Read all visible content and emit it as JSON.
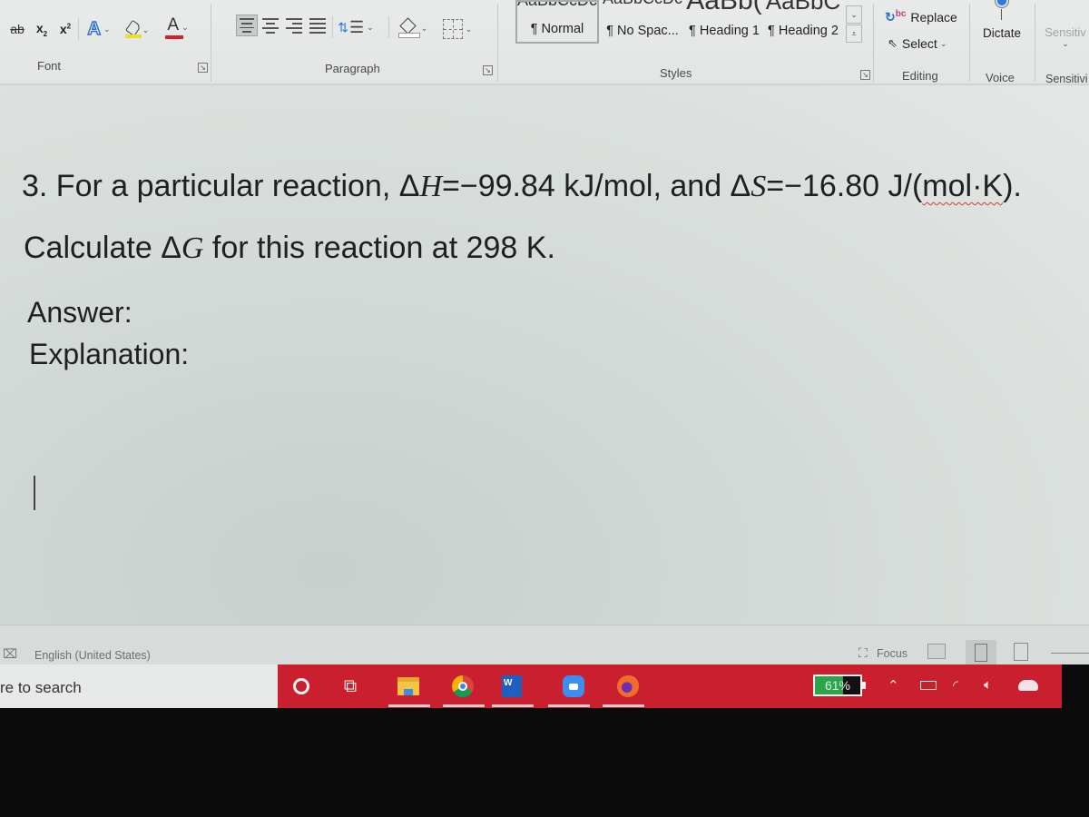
{
  "ribbon": {
    "font_group": {
      "label": "Font",
      "buttons": {
        "strikethrough": "ab",
        "subscript": "x",
        "superscript": "x",
        "text_effects": "A",
        "font_color": "A"
      }
    },
    "paragraph_group": {
      "label": "Paragraph"
    },
    "styles_group": {
      "label": "Styles",
      "previews": [
        "AaBbCcDc",
        "AaBbCcDc",
        "AaBb(",
        "AaBbC"
      ],
      "items": [
        {
          "label": "¶ Normal",
          "selected": true
        },
        {
          "label": "¶ No Spac...",
          "selected": false
        },
        {
          "label": "¶ Heading 1",
          "selected": false
        },
        {
          "label": "¶ Heading 2",
          "selected": false
        }
      ]
    },
    "editing_group": {
      "label": "Editing",
      "replace_label": "Replace",
      "select_label": "Select"
    },
    "voice_group": {
      "label": "Voice",
      "dictate_label": "Dictate"
    },
    "sensitivity_group": {
      "label": "Sensitivi",
      "button_label": "Sensitiv"
    }
  },
  "document": {
    "question": {
      "prefix": "3. For a particular reaction, Δ",
      "var1": "H",
      "mid": "=−99.84 kJ/mol, and Δ",
      "var2": "S",
      "value2": "=−16.80 J/(",
      "unit_flagged": "mol·K",
      "suffix": ")."
    },
    "instruction": {
      "prefix": "Calculate Δ",
      "var": "G",
      "suffix": " for this reaction at 298 K."
    },
    "answer_label": "Answer:",
    "explanation_label": "Explanation:"
  },
  "statusbar": {
    "language": "English (United States)",
    "focus_label": "Focus"
  },
  "taskbar": {
    "search_placeholder": "re to search",
    "apps": [
      "cortana",
      "task-view",
      "file-explorer",
      "chrome",
      "word",
      "zoom",
      "firefox"
    ],
    "battery_percent": 61,
    "battery_label": "61%",
    "colors": {
      "taskbar": "#c91f2e",
      "battery_fill": "#2aa54a"
    }
  }
}
